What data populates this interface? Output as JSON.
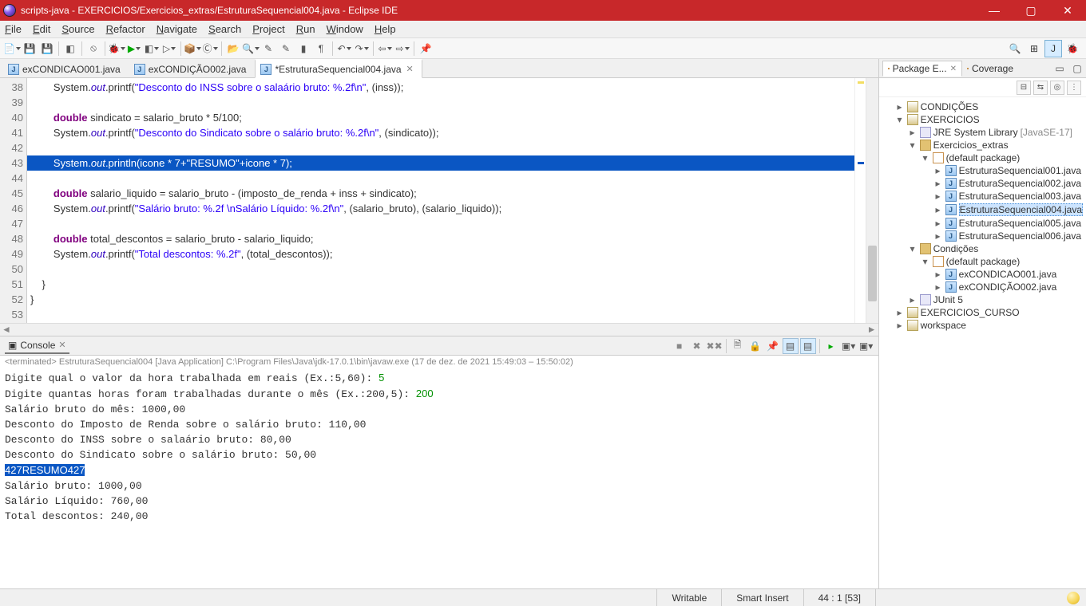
{
  "titlebar": {
    "title": "scripts-java - EXERCICIOS/Exercicios_extras/EstruturaSequencial004.java - Eclipse IDE"
  },
  "menus": [
    "File",
    "Edit",
    "Source",
    "Refactor",
    "Navigate",
    "Search",
    "Project",
    "Run",
    "Window",
    "Help"
  ],
  "editor": {
    "tabs": [
      {
        "label": "exCONDICAO001.java",
        "active": false
      },
      {
        "label": "exCONDIÇÃO002.java",
        "active": false
      },
      {
        "label": "*EstruturaSequencial004.java",
        "active": true
      }
    ],
    "first_line": 38,
    "lines": [
      {
        "html": "        System.<span class='it'>out</span>.printf(<span class='str'>\"Desconto do INSS sobre o salaário bruto: %.2f\\n\"</span>, (inss));"
      },
      {
        "html": ""
      },
      {
        "html": "        <span class='kw'>double</span> sindicato = salario_bruto * 5/100;"
      },
      {
        "html": "        System.<span class='it'>out</span>.printf(<span class='str'>\"Desconto do Sindicato sobre o salário bruto: %.2f\\n\"</span>, (sindicato));"
      },
      {
        "html": ""
      },
      {
        "html": "        System.<span class='it'>out</span>.println(icone * 7+<span class='str'>\"RESUMO\"</span>+icone * 7);",
        "sel": true
      },
      {
        "html": ""
      },
      {
        "html": "        <span class='kw'>double</span> salario_liquido = salario_bruto - (imposto_de_renda + inss + sindicato);"
      },
      {
        "html": "        System.<span class='it'>out</span>.printf(<span class='str'>\"Salário bruto: %.2f \\nSalário Líquido: %.2f\\n\"</span>, (salario_bruto), (salario_liquido));"
      },
      {
        "html": ""
      },
      {
        "html": "        <span class='kw'>double</span> total_descontos = salario_bruto - salario_liquido;"
      },
      {
        "html": "        System.<span class='it'>out</span>.printf(<span class='str'>\"Total descontos: %.2f\"</span>, (total_descontos));"
      },
      {
        "html": ""
      },
      {
        "html": "    }"
      },
      {
        "html": "}"
      },
      {
        "html": ""
      }
    ]
  },
  "console": {
    "tab_label": "Console",
    "info": "<terminated> EstruturaSequencial004 [Java Application] C:\\Program Files\\Java\\jdk-17.0.1\\bin\\javaw.exe  (17 de dez. de 2021 15:49:03 – 15:50:02)",
    "lines": [
      {
        "text": "Digite qual o valor da hora trabalhada em reais (Ex.:5,60): ",
        "user": "5"
      },
      {
        "text": "Digite quantas horas foram trabalhadas durante o mês (Ex.:200,5): ",
        "user": "200"
      },
      {
        "text": "Salário bruto do mês: 1000,00"
      },
      {
        "text": "Desconto do Imposto de Renda sobre o salário bruto: 110,00"
      },
      {
        "text": "Desconto do INSS sobre o salaário bruto: 80,00"
      },
      {
        "text": "Desconto do Sindicato sobre o salário bruto: 50,00"
      },
      {
        "text": "427RESUMO427",
        "sel": true
      },
      {
        "text": "Salário bruto: 1000,00"
      },
      {
        "text": "Salário Líquido: 760,00"
      },
      {
        "text": "Total descontos: 240,00"
      }
    ]
  },
  "right_panel": {
    "tabs": [
      {
        "label": "Package E...",
        "active": true,
        "closable": true
      },
      {
        "label": "Coverage",
        "active": false
      }
    ]
  },
  "tree": {
    "projects": [
      {
        "label": "CONDIÇÕES",
        "expanded": false
      },
      {
        "label": "EXERCICIOS",
        "expanded": true,
        "children": [
          {
            "label": "JRE System Library",
            "suffix": " [JavaSE-17]",
            "type": "jre"
          },
          {
            "label": "Exercicios_extras",
            "type": "srcfold",
            "expanded": true,
            "children": [
              {
                "label": "(default package)",
                "type": "pack",
                "expanded": true,
                "children": [
                  {
                    "label": "EstruturaSequencial001.java",
                    "type": "java"
                  },
                  {
                    "label": "EstruturaSequencial002.java",
                    "type": "java"
                  },
                  {
                    "label": "EstruturaSequencial003.java",
                    "type": "java"
                  },
                  {
                    "label": "EstruturaSequencial004.java",
                    "type": "java",
                    "selected": true
                  },
                  {
                    "label": "EstruturaSequencial005.java",
                    "type": "java"
                  },
                  {
                    "label": "EstruturaSequencial006.java",
                    "type": "java"
                  }
                ]
              }
            ]
          },
          {
            "label": "Condições",
            "type": "srcfold",
            "expanded": true,
            "children": [
              {
                "label": "(default package)",
                "type": "pack",
                "expanded": true,
                "children": [
                  {
                    "label": "exCONDICAO001.java",
                    "type": "java"
                  },
                  {
                    "label": "exCONDIÇÃO002.java",
                    "type": "java"
                  }
                ]
              }
            ]
          },
          {
            "label": "JUnit 5",
            "type": "jre"
          }
        ]
      },
      {
        "label": "EXERCICIOS_CURSO",
        "expanded": false
      },
      {
        "label": "workspace",
        "expanded": false
      }
    ]
  },
  "statusbar": {
    "writable": "Writable",
    "mode": "Smart Insert",
    "pos": "44 : 1 [53]"
  }
}
